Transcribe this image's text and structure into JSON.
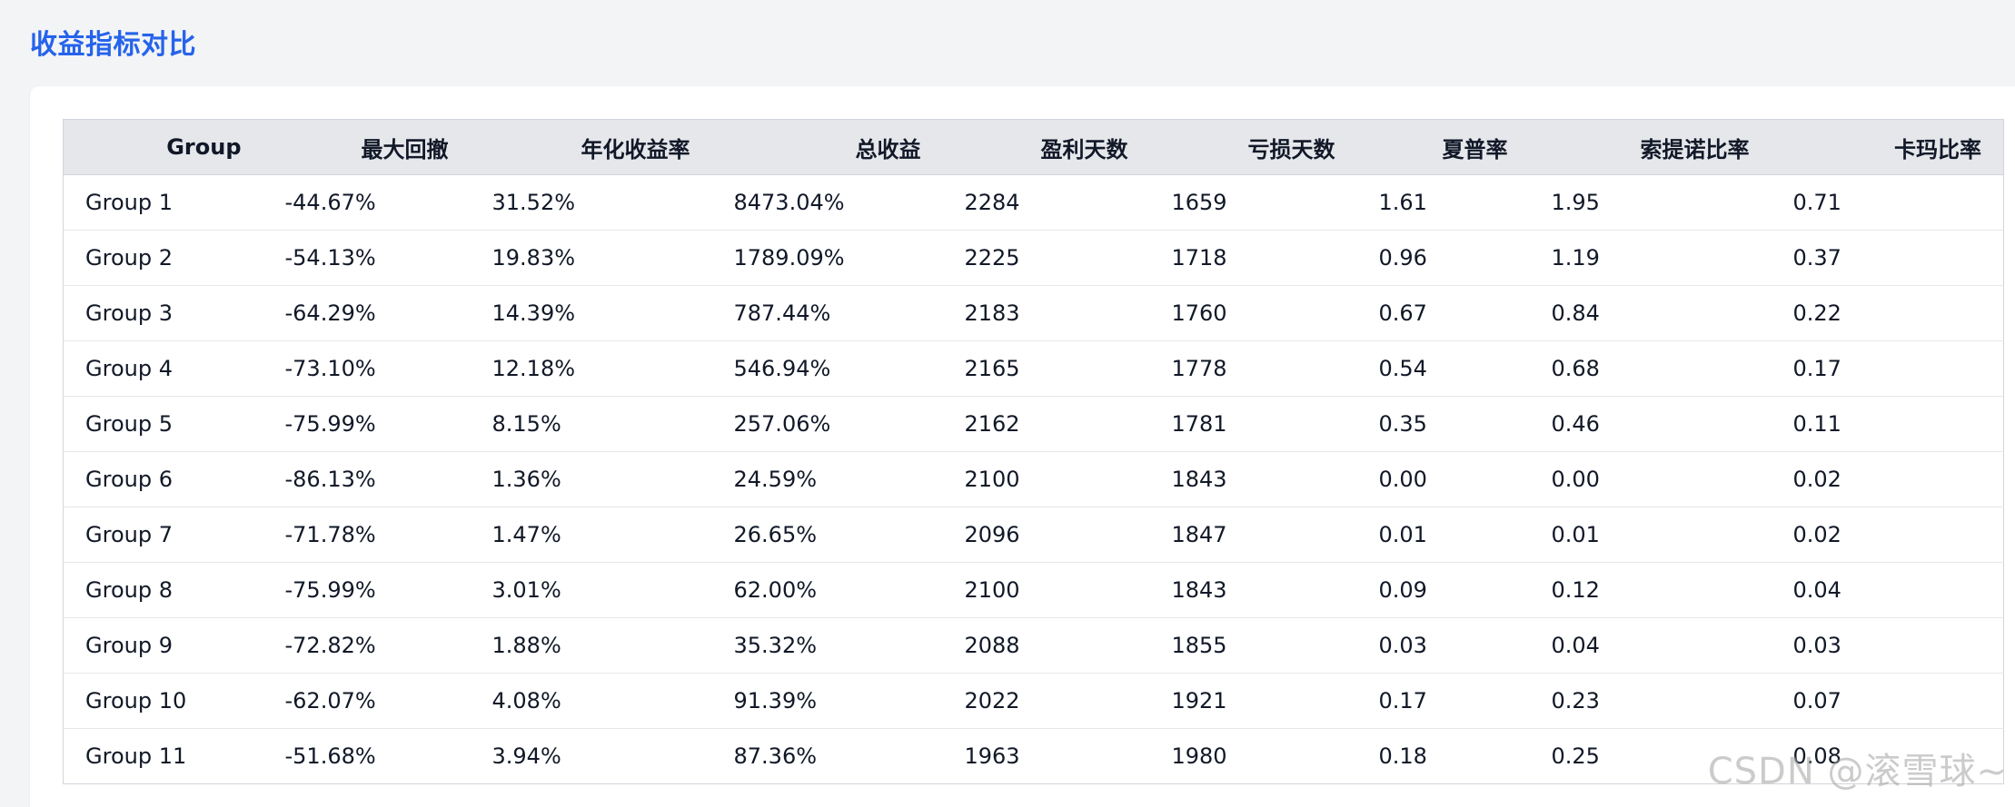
{
  "page": {
    "title": "收益指标对比",
    "title_color": "#2563eb"
  },
  "table": {
    "columns": [
      "Group",
      "最大回撤",
      "年化收益率",
      "总收益",
      "盈利天数",
      "亏损天数",
      "夏普率",
      "索提诺比率",
      "卡玛比率"
    ],
    "rows": [
      [
        "Group 1",
        "-44.67%",
        "31.52%",
        "8473.04%",
        "2284",
        "1659",
        "1.61",
        "1.95",
        "0.71"
      ],
      [
        "Group 2",
        "-54.13%",
        "19.83%",
        "1789.09%",
        "2225",
        "1718",
        "0.96",
        "1.19",
        "0.37"
      ],
      [
        "Group 3",
        "-64.29%",
        "14.39%",
        "787.44%",
        "2183",
        "1760",
        "0.67",
        "0.84",
        "0.22"
      ],
      [
        "Group 4",
        "-73.10%",
        "12.18%",
        "546.94%",
        "2165",
        "1778",
        "0.54",
        "0.68",
        "0.17"
      ],
      [
        "Group 5",
        "-75.99%",
        "8.15%",
        "257.06%",
        "2162",
        "1781",
        "0.35",
        "0.46",
        "0.11"
      ],
      [
        "Group 6",
        "-86.13%",
        "1.36%",
        "24.59%",
        "2100",
        "1843",
        "0.00",
        "0.00",
        "0.02"
      ],
      [
        "Group 7",
        "-71.78%",
        "1.47%",
        "26.65%",
        "2096",
        "1847",
        "0.01",
        "0.01",
        "0.02"
      ],
      [
        "Group 8",
        "-75.99%",
        "3.01%",
        "62.00%",
        "2100",
        "1843",
        "0.09",
        "0.12",
        "0.04"
      ],
      [
        "Group 9",
        "-72.82%",
        "1.88%",
        "35.32%",
        "2088",
        "1855",
        "0.03",
        "0.04",
        "0.03"
      ],
      [
        "Group 10",
        "-62.07%",
        "4.08%",
        "91.39%",
        "2022",
        "1921",
        "0.17",
        "0.23",
        "0.07"
      ],
      [
        "Group 11",
        "-51.68%",
        "3.94%",
        "87.36%",
        "1963",
        "1980",
        "0.18",
        "0.25",
        "0.08"
      ]
    ]
  },
  "watermark": {
    "text": "CSDN @滚雪球~"
  }
}
